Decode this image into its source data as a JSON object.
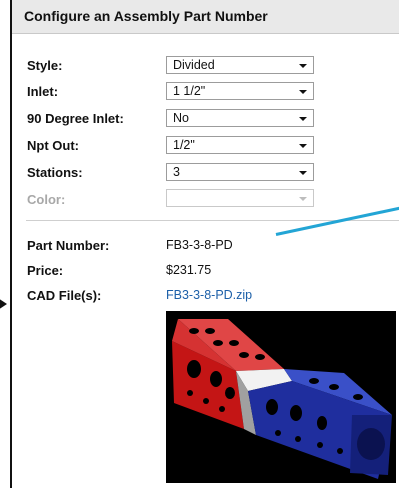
{
  "header": {
    "title": "Configure an Assembly Part Number"
  },
  "form": {
    "rows": [
      {
        "label": "Style:",
        "value": "Divided"
      },
      {
        "label": "Inlet:",
        "value": "1 1/2\""
      },
      {
        "label": "90 Degree Inlet:",
        "value": "No"
      },
      {
        "label": "Npt Out:",
        "value": "1/2\""
      },
      {
        "label": "Stations:",
        "value": "3"
      },
      {
        "label": "Color:",
        "value": ""
      }
    ]
  },
  "details": {
    "part_number_label": "Part Number:",
    "part_number": "FB3-3-8-PD",
    "price_label": "Price:",
    "price": "$231.75",
    "cad_label": "CAD File(s):",
    "cad_file": "FB3-3-8-PD.zip"
  },
  "colors": {
    "link": "#1c5fa8",
    "annotation_line": "#23a5d5",
    "manifold_red": "#d91f1f",
    "manifold_blue": "#1f2e9e",
    "divider_gray": "#a9a9a9"
  }
}
